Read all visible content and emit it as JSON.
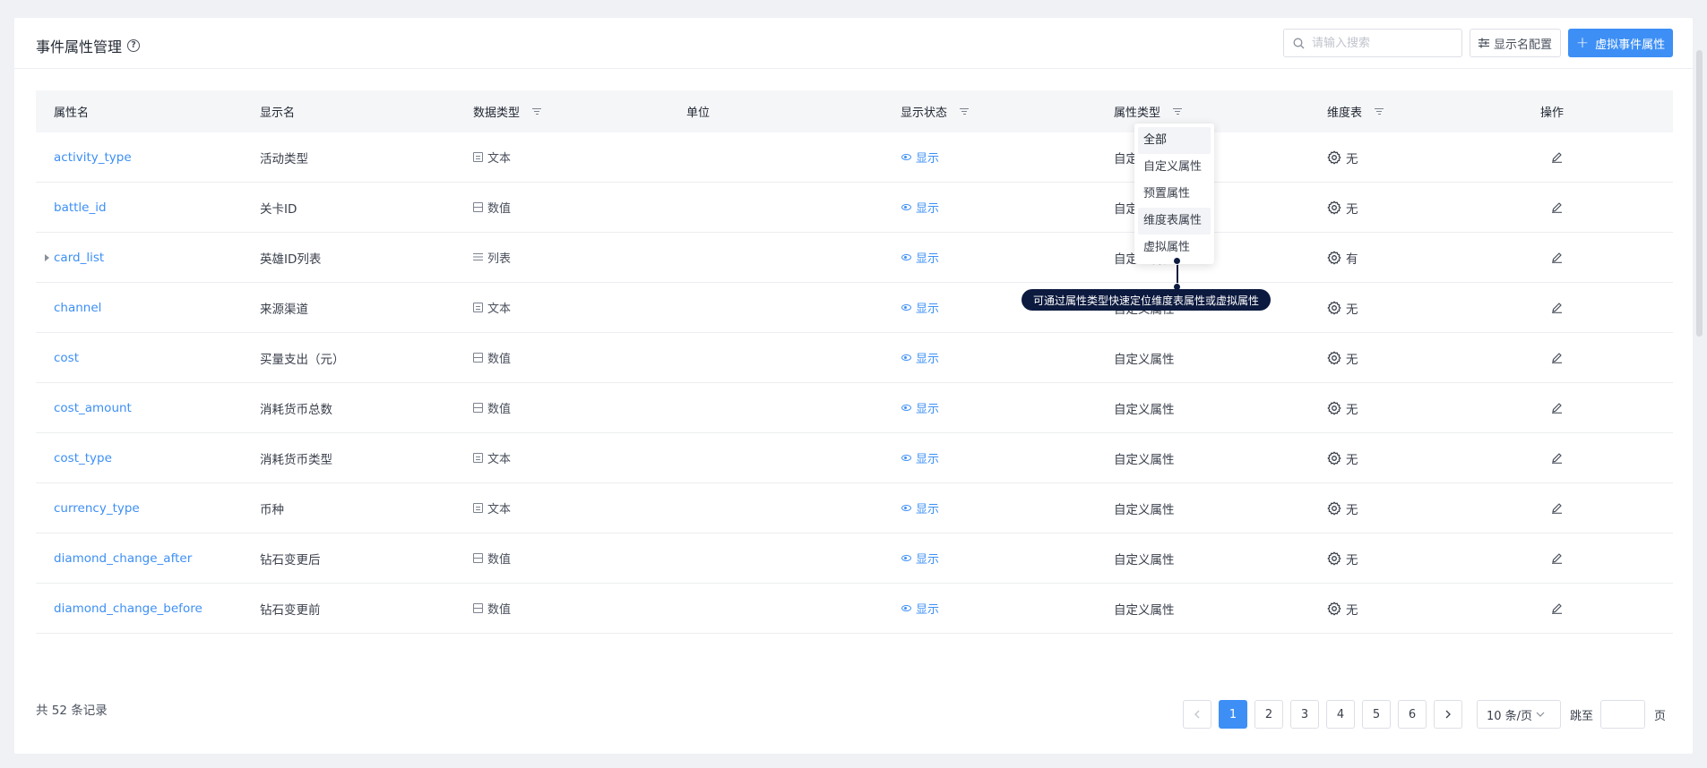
{
  "header": {
    "title": "事件属性管理",
    "search_placeholder": "请输入搜索",
    "config_button": "显示名配置",
    "virtual_button": "虚拟事件属性"
  },
  "columns": [
    "属性名",
    "显示名",
    "数据类型",
    "单位",
    "显示状态",
    "属性类型",
    "维度表",
    "操作"
  ],
  "rows": [
    {
      "name": "activity_type",
      "display": "活动类型",
      "dtype": "文本",
      "dtype_icon": "text-doc-icon",
      "unit": "",
      "status": "显示",
      "attr_type": "自定义属性",
      "dim": "无",
      "expandable": false
    },
    {
      "name": "battle_id",
      "display": "关卡ID",
      "dtype": "数值",
      "dtype_icon": "number-icon",
      "unit": "",
      "status": "显示",
      "attr_type": "自定义属性",
      "dim": "无",
      "expandable": false
    },
    {
      "name": "card_list",
      "display": "英雄ID列表",
      "dtype": "列表",
      "dtype_icon": "list-icon",
      "unit": "",
      "status": "显示",
      "attr_type": "自定义属性",
      "dim": "有",
      "expandable": true
    },
    {
      "name": "channel",
      "display": "来源渠道",
      "dtype": "文本",
      "dtype_icon": "text-doc-icon",
      "unit": "",
      "status": "显示",
      "attr_type": "自定义属性",
      "dim": "无",
      "expandable": false
    },
    {
      "name": "cost",
      "display": "买量支出（元）",
      "dtype": "数值",
      "dtype_icon": "number-icon",
      "unit": "",
      "status": "显示",
      "attr_type": "自定义属性",
      "dim": "无",
      "expandable": false
    },
    {
      "name": "cost_amount",
      "display": "消耗货币总数",
      "dtype": "数值",
      "dtype_icon": "number-icon",
      "unit": "",
      "status": "显示",
      "attr_type": "自定义属性",
      "dim": "无",
      "expandable": false
    },
    {
      "name": "cost_type",
      "display": "消耗货币类型",
      "dtype": "文本",
      "dtype_icon": "text-doc-icon",
      "unit": "",
      "status": "显示",
      "attr_type": "自定义属性",
      "dim": "无",
      "expandable": false
    },
    {
      "name": "currency_type",
      "display": "币种",
      "dtype": "文本",
      "dtype_icon": "text-doc-icon",
      "unit": "",
      "status": "显示",
      "attr_type": "自定义属性",
      "dim": "无",
      "expandable": false
    },
    {
      "name": "diamond_change_after",
      "display": "钻石变更后",
      "dtype": "数值",
      "dtype_icon": "number-icon",
      "unit": "",
      "status": "显示",
      "attr_type": "自定义属性",
      "dim": "无",
      "expandable": false
    },
    {
      "name": "diamond_change_before",
      "display": "钻石变更前",
      "dtype": "数值",
      "dtype_icon": "number-icon",
      "unit": "",
      "status": "显示",
      "attr_type": "自定义属性",
      "dim": "无",
      "expandable": false
    }
  ],
  "filter_dropdown": {
    "items": [
      "全部",
      "自定义属性",
      "预置属性",
      "维度表属性",
      "虚拟属性"
    ],
    "selected": "全部"
  },
  "tooltip": "可通过属性类型快速定位维度表属性或虚拟属性",
  "footer": {
    "total": "共 52 条记录",
    "pages": [
      "1",
      "2",
      "3",
      "4",
      "5",
      "6"
    ],
    "current_page": "1",
    "page_size": "10 条/页",
    "jump_label": "跳至",
    "page_suffix": "页"
  },
  "colors": {
    "primary": "#3d8ff5",
    "tooltip_bg": "#0c1a3f",
    "header_bg": "#f5f6f8"
  }
}
